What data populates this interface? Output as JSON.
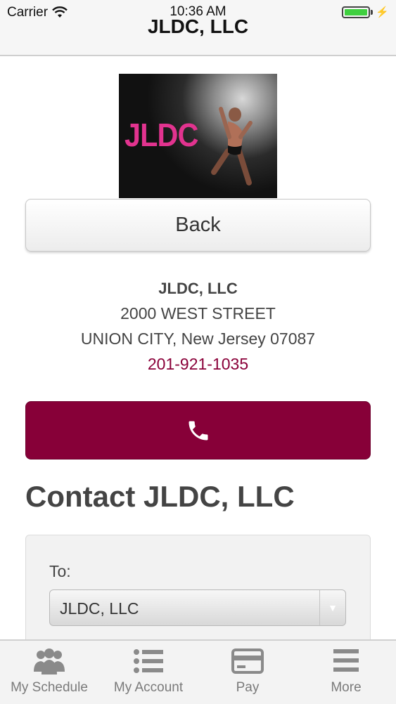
{
  "status_bar": {
    "carrier": "Carrier",
    "time": "10:36 AM"
  },
  "header": {
    "title": "JLDC, LLC"
  },
  "logo": {
    "text": "JLDC"
  },
  "back_button": {
    "label": "Back"
  },
  "business": {
    "name": "JLDC, LLC",
    "street": "2000 WEST STREET",
    "city_line": "UNION CITY, New Jersey 07087",
    "phone": "201-921-1035"
  },
  "call_button": {
    "icon": "phone-icon"
  },
  "contact": {
    "title": "Contact JLDC, LLC",
    "to_label": "To:",
    "to_selected": "JLDC, LLC"
  },
  "tabs": [
    {
      "label": "My Schedule",
      "icon": "people-icon"
    },
    {
      "label": "My Account",
      "icon": "list-icon"
    },
    {
      "label": "Pay",
      "icon": "card-icon"
    },
    {
      "label": "More",
      "icon": "menu-icon"
    }
  ],
  "colors": {
    "accent": "#870038",
    "phone_text": "#8a0039",
    "battery": "#3fcf3f"
  }
}
